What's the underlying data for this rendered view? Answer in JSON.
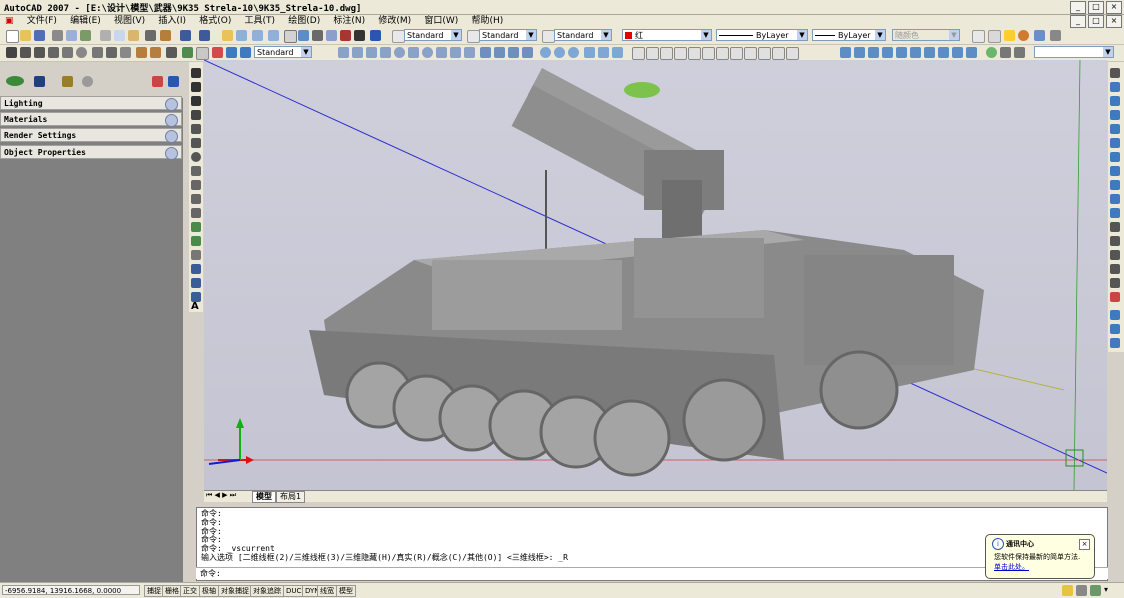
{
  "window": {
    "title": "AutoCAD 2007 - [E:\\设计\\模型\\武器\\9K35 Strela-10\\9K35_Strela-10.dwg]",
    "min": "_",
    "max": "□",
    "close": "×"
  },
  "menu": [
    "文件(F)",
    "编辑(E)",
    "视图(V)",
    "插入(I)",
    "格式(O)",
    "工具(T)",
    "绘图(D)",
    "标注(N)",
    "修改(M)",
    "窗口(W)",
    "帮助(H)"
  ],
  "styles": {
    "text_style": "Standard",
    "dim_style": "Standard",
    "table_style": "Standard",
    "layer": "红",
    "linetype": "ByLayer",
    "lineweight": "ByLayer",
    "plotstyle": "随颜色",
    "workspace": "Standard"
  },
  "palette": {
    "sections": [
      "Lighting",
      "Materials",
      "Render Settings",
      "Object Properties"
    ]
  },
  "tabs": [
    "模型",
    "布局1"
  ],
  "command": {
    "history": [
      "命令:",
      "命令:",
      "命令:",
      "命令:",
      "命令:  _vscurrent",
      "输入选项 [二维线框(2)/三维线框(3)/三维隐藏(H)/真实(R)/概念(C)/其他(O)] <三维线框>: _R"
    ],
    "prompt": "命令:"
  },
  "status": {
    "coords": "-6956.9184, 13916.1668, 0.0000",
    "toggles": [
      "捕捉",
      "栅格",
      "正交",
      "极轴",
      "对象捕捉",
      "对象追踪",
      "DUCS",
      "DYN",
      "线宽",
      "模型"
    ]
  },
  "balloon": {
    "title": "通讯中心",
    "body": "您软件保持最新的简单方法.",
    "link": "单击此处。"
  },
  "colors": {
    "layer_swatch": "#e00000",
    "viewport_bg": "#cbcbd8",
    "ucs_x": "#e01010",
    "ucs_y": "#10b010",
    "ucs_z": "#1020d0"
  }
}
